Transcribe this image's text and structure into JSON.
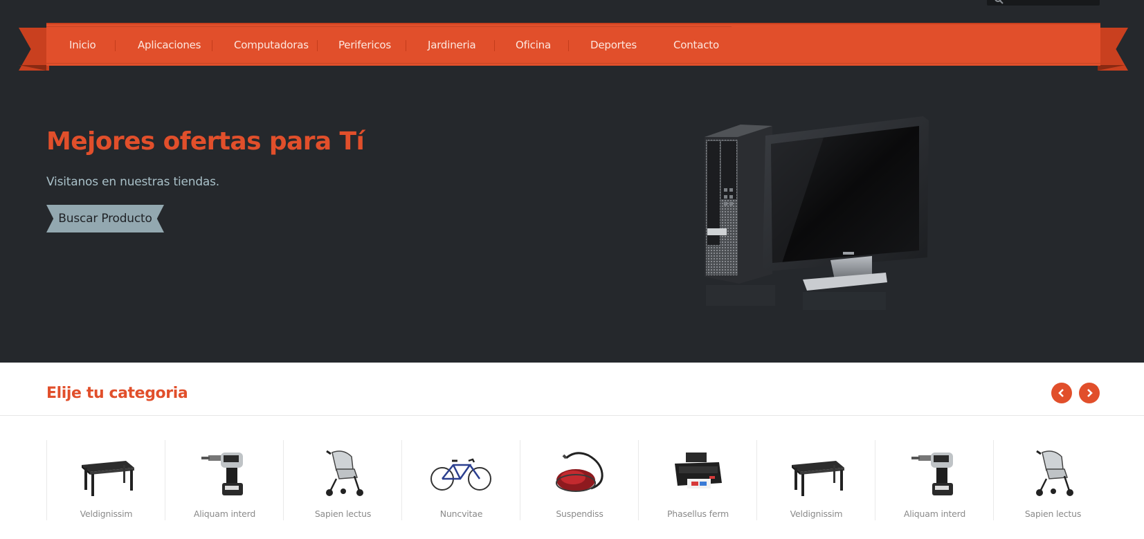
{
  "nav": {
    "items": [
      {
        "label": "Inicio"
      },
      {
        "label": "Aplicaciones"
      },
      {
        "label": "Computadoras"
      },
      {
        "label": "Perifericos"
      },
      {
        "label": "Jardineria"
      },
      {
        "label": "Oficina"
      },
      {
        "label": "Deportes"
      },
      {
        "label": "Contacto"
      }
    ]
  },
  "hero": {
    "title": "Mejores ofertas para Tí",
    "subtitle": "Visitanos en nuestras tiendas.",
    "button_label": "Buscar Producto",
    "image_icon": "desktop-computer-image"
  },
  "categories": {
    "title": "Elije tu categoria",
    "prev_icon": "chevron-left-icon",
    "next_icon": "chevron-right-icon",
    "items": [
      {
        "label": "Veldignissim",
        "icon": "table-image"
      },
      {
        "label": "Aliquam interd",
        "icon": "drill-image"
      },
      {
        "label": "Sapien lectus",
        "icon": "stroller-image"
      },
      {
        "label": "Nuncvitae",
        "icon": "bicycle-image"
      },
      {
        "label": "Suspendiss",
        "icon": "vacuum-image"
      },
      {
        "label": "Phasellus ferm",
        "icon": "printer-image"
      },
      {
        "label": "Veldignissim",
        "icon": "table-image"
      },
      {
        "label": "Aliquam interd",
        "icon": "drill-image"
      },
      {
        "label": "Sapien lectus",
        "icon": "stroller-image"
      }
    ]
  },
  "colors": {
    "accent": "#e14f2b",
    "dark_bg": "#25282c",
    "button_bg": "#93a8b0"
  }
}
